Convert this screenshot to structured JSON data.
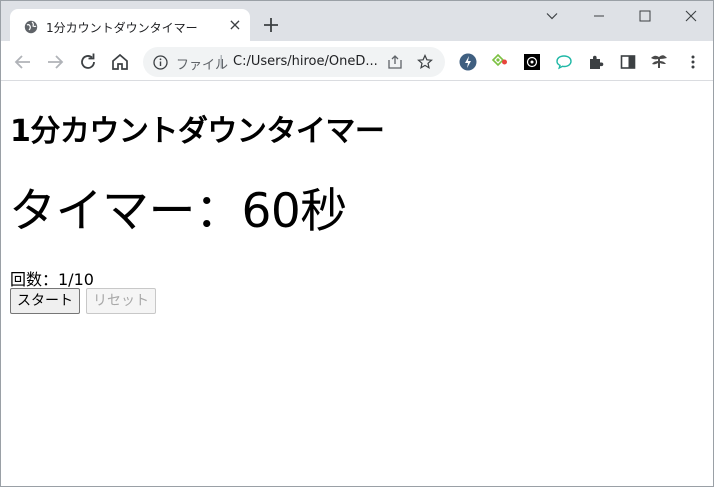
{
  "browser": {
    "tab_title": "1分カウントダウンタイマー",
    "tab_close": "×",
    "address_scheme": "ファイル",
    "address_separator": "|",
    "address_url": "C:/Users/hiroe/OneD..."
  },
  "page": {
    "title": "1分カウントダウンタイマー",
    "timer_text": "タイマー：60秒",
    "count_text": "回数：1/10",
    "start_label": "スタート",
    "reset_label": "リセット"
  },
  "icons": {
    "favicon": "globe-icon",
    "new_tab": "plus-icon",
    "minimize": "minimize-icon",
    "maximize": "maximize-icon",
    "close": "close-icon",
    "tab_search": "chevron-down-icon",
    "back": "back-arrow-icon",
    "forward": "forward-arrow-icon",
    "reload": "reload-icon",
    "home": "home-icon",
    "info": "info-icon",
    "share": "share-icon",
    "bookmark": "star-icon",
    "extensions": [
      "lightning-extension-icon",
      "diamond-extension-icon",
      "chatgpt-extension-icon",
      "chat-bubble-extension-icon",
      "puzzle-icon",
      "side-panel-icon",
      "profile-avatar-icon",
      "kebab-menu-icon"
    ]
  },
  "colors": {
    "tabstrip_bg": "#dee1e6",
    "omnibox_bg": "#f1f3f4",
    "disabled_text": "#a8a8a8"
  }
}
